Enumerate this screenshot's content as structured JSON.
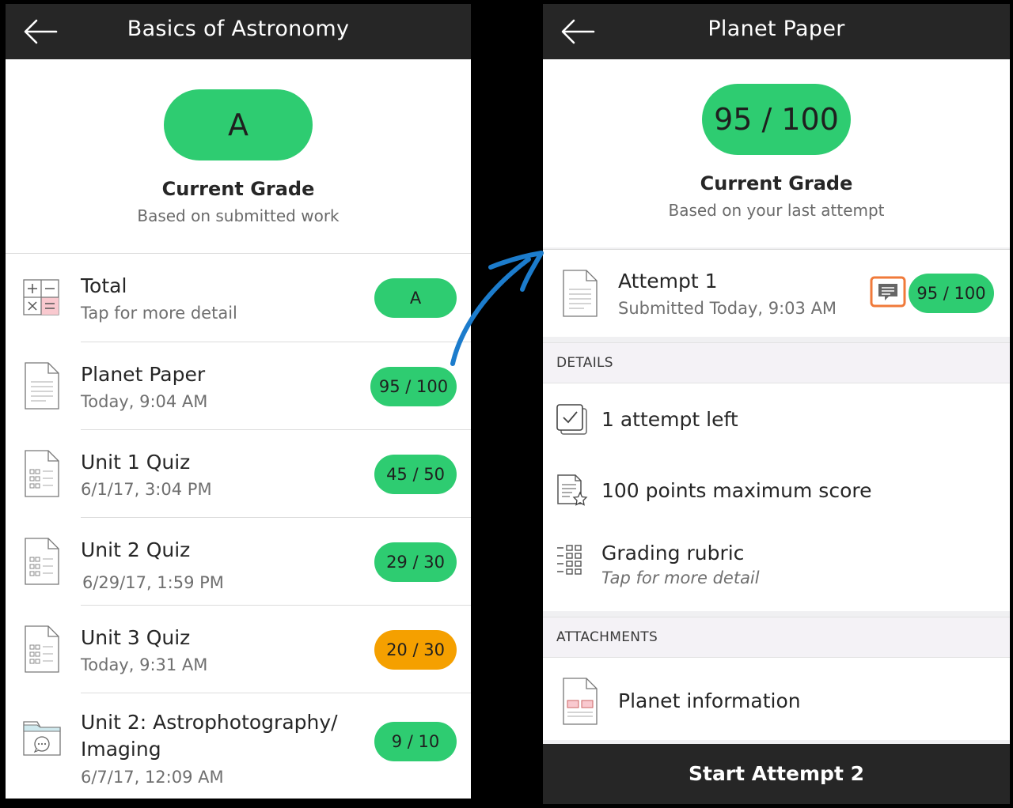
{
  "left": {
    "title": "Basics of Astronomy",
    "grade_value": "A",
    "grade_title": "Current Grade",
    "grade_subtitle": "Based on submitted work",
    "items": [
      {
        "title": "Total",
        "subtitle": "Tap for more detail",
        "score": "A",
        "icon": "calculator-icon",
        "color": "#2ecc71"
      },
      {
        "title": "Planet Paper",
        "subtitle": "Today, 9:04 AM",
        "score": "95 / 100",
        "icon": "document-icon",
        "color": "#2ecc71"
      },
      {
        "title": "Unit 1 Quiz",
        "subtitle": "6/1/17, 3:04 PM",
        "score": "45 / 50",
        "icon": "quiz-icon",
        "color": "#2ecc71"
      },
      {
        "title": "Unit 2 Quiz",
        "subtitle": "6/29/17, 1:59 PM",
        "score": "29 / 30",
        "icon": "quiz-icon",
        "color": "#2ecc71"
      },
      {
        "title": "Unit 3 Quiz",
        "subtitle": "Today, 9:31 AM",
        "score": "20 / 30",
        "icon": "quiz-icon",
        "color": "#f5a000"
      },
      {
        "title": "Unit 2: Astrophotography/",
        "title2": "Imaging",
        "subtitle": "6/7/17, 12:09 AM",
        "score": "9 / 10",
        "icon": "discussion-folder-icon",
        "color": "#2ecc71"
      }
    ]
  },
  "right": {
    "title": "Planet Paper",
    "grade_value": "95 / 100",
    "grade_title": "Current Grade",
    "grade_subtitle": "Based on your last attempt",
    "attempt": {
      "title": "Attempt 1",
      "subtitle": "Submitted Today, 9:03 AM",
      "score": "95 / 100",
      "feedback_icon": "feedback-comment-icon"
    },
    "details_header": "DETAILS",
    "details": [
      {
        "text": "1 attempt left",
        "icon": "attempts-checkbox-icon"
      },
      {
        "text": "100 points maximum score",
        "icon": "max-score-icon"
      },
      {
        "text": "Grading rubric",
        "subtitle": "Tap for more detail",
        "icon": "rubric-icon"
      }
    ],
    "attachments_header": "ATTACHMENTS",
    "attachment": {
      "text": "Planet information",
      "icon": "attachment-file-icon"
    },
    "start_button": "Start Attempt 2"
  },
  "colors": {
    "green": "#2ecc71",
    "orange": "#f5a000",
    "bar": "#262626",
    "arrow": "#1c7ccc",
    "highlight": "#f07a3a"
  }
}
